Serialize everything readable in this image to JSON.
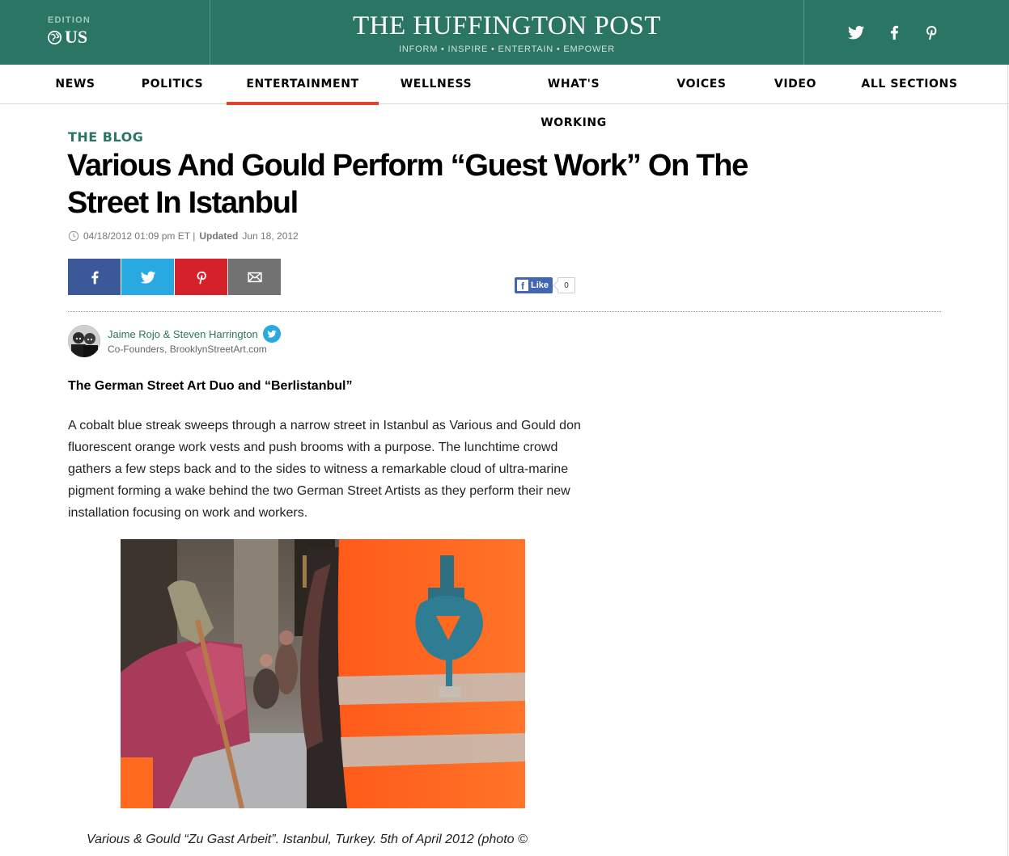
{
  "header": {
    "edition_label": "EDITION",
    "edition_value": "US",
    "brand_title": "THE HUFFINGTON POST",
    "brand_tagline": "INFORM • INSPIRE • ENTERTAIN • EMPOWER",
    "social": [
      {
        "icon": "twitter-icon"
      },
      {
        "icon": "facebook-icon"
      },
      {
        "icon": "pinterest-icon"
      }
    ],
    "colors": {
      "brand_green": "#2b7564",
      "accent_red": "#e4442a"
    }
  },
  "nav": {
    "items": [
      {
        "label": "NEWS"
      },
      {
        "label": "POLITICS"
      },
      {
        "label": "ENTERTAINMENT",
        "active": true
      },
      {
        "label": "WELLNESS"
      },
      {
        "label": "WHAT'S WORKING"
      },
      {
        "label": "VOICES"
      },
      {
        "label": "VIDEO"
      },
      {
        "label": "ALL SECTIONS"
      }
    ]
  },
  "article": {
    "kicker": "THE BLOG",
    "headline": "Various And Gould Perform “Guest Work” On The Street In Istanbul",
    "published": "04/18/2012 01:09 pm ET |",
    "updated_label": "Updated",
    "updated_date": "Jun 18, 2012",
    "share_buttons": [
      {
        "icon": "facebook-icon",
        "color": "#3b5998"
      },
      {
        "icon": "twitter-icon",
        "color": "#28a9e0"
      },
      {
        "icon": "pinterest-icon",
        "color": "#d5222a"
      },
      {
        "icon": "email-icon",
        "color": "#727272"
      }
    ],
    "fb_like": {
      "label": "Like",
      "count": "0"
    },
    "author": {
      "name": "Jaime Rojo & Steven Harrington",
      "role": "Co-Founders, BrooklynStreetArt.com"
    },
    "subhead": "The German Street Art Duo and “Berlistanbul”",
    "body": "A cobalt blue streak sweeps through a narrow street in Istanbul as Various and Gould don fluorescent orange work vests and push brooms with a purpose. The lunchtime crowd gathers a few steps back and to the sides to witness a remarkable cloud of ultra-marine pigment forming a wake behind the two German Street Artists as they perform their new installation focusing on work and workers.",
    "caption": "Various & Gould “Zu Gast Arbeit”. Istanbul, Turkey. 5th of April 2012 (photo ©"
  }
}
